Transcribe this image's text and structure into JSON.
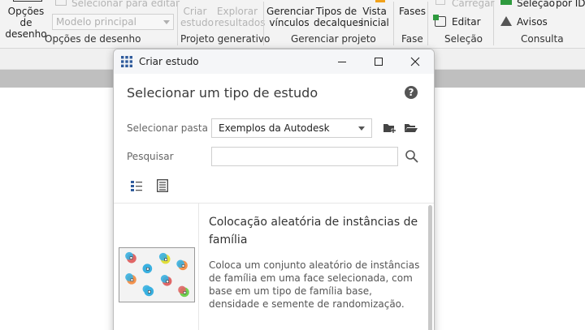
{
  "ribbon": {
    "opcoes_desenho_label": "Opções de desenho",
    "selecionar_editar": "Selecionar para editar",
    "modelo_principal": "Modelo principal",
    "criar_estudo": "Criar estudo",
    "explorar_resultados": "Explorar resultados",
    "gerenciar_vinculos": "Gerenciar vínculos",
    "tipos_decalques": "Tipos de decalques",
    "vista_inicial": "Vista inicial",
    "fases": "Fases",
    "carregar": "Carregar",
    "editar": "Editar",
    "selecao": "Seleção",
    "por_id": "por ID",
    "avisos": "Avisos",
    "groups": {
      "opcoes": "Opções de desenho",
      "projeto_generativo": "Projeto generativo",
      "gerenciar_projeto": "Gerenciar projeto",
      "fase": "Fase",
      "selecao": "Seleção",
      "consulta": "Consulta"
    }
  },
  "dialog": {
    "title": "Criar estudo",
    "heading": "Selecionar um tipo de estudo",
    "help": "?",
    "folder_label": "Selecionar pasta",
    "folder_value": "Exemplos da Autodesk",
    "search_label": "Pesquisar",
    "search_placeholder": "",
    "item": {
      "title": "Colocação aleatória de instâncias de família",
      "description": "Coloca um conjunto aleatório de instâncias de família em uma face selecionada, com base em um tipo de família base, densidade e semente de randomização."
    }
  },
  "colors": {
    "accent": "#2f5b9c",
    "gray_band": "#bfbfbf"
  },
  "icons": [
    "grid-app-icon",
    "minimize-icon",
    "maximize-icon",
    "close-icon",
    "help-icon",
    "new-folder-icon",
    "open-folder-icon",
    "search-icon",
    "list-view-icon",
    "detail-view-icon"
  ]
}
